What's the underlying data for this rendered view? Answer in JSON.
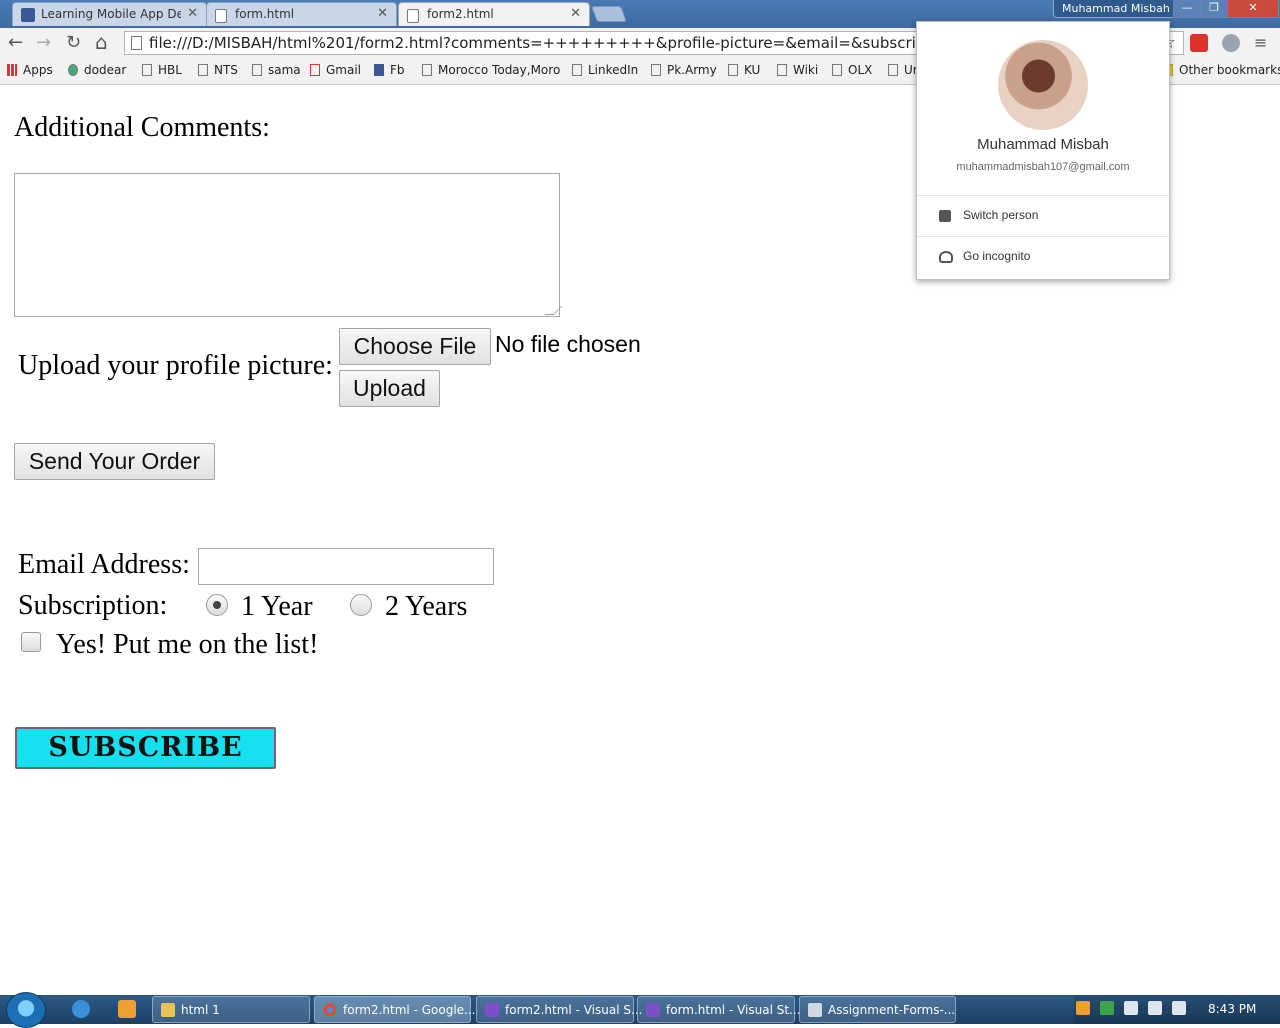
{
  "window": {
    "profile_name": "Muhammad Misbah",
    "min_glyph": "—",
    "max_glyph": "❐",
    "close_glyph": "✕"
  },
  "tabs": [
    {
      "label": "Learning Mobile App Deve",
      "favicon": "facebook-icon",
      "favicon_color": "#3b5998"
    },
    {
      "label": "form.html",
      "favicon": "document-icon",
      "favicon_color": "#ffffff"
    },
    {
      "label": "form2.html",
      "favicon": "document-icon",
      "favicon_color": "#ffffff",
      "active": true
    }
  ],
  "toolbar": {
    "back": "←",
    "forward": "→",
    "reload": "↻",
    "home": "⌂",
    "url": "file:///D:/MISBAH/html%201/form2.html?comments=+++++++++&profile-picture=&email=&subscription=",
    "star": "☆"
  },
  "bookmarks": [
    {
      "label": "Apps"
    },
    {
      "label": "dodear"
    },
    {
      "label": "HBL"
    },
    {
      "label": "NTS"
    },
    {
      "label": "sama"
    },
    {
      "label": "Gmail"
    },
    {
      "label": "Fb"
    },
    {
      "label": "Morocco Today,Moro"
    },
    {
      "label": "LinkedIn"
    },
    {
      "label": "Pk.Army"
    },
    {
      "label": "KU"
    },
    {
      "label": "Wiki"
    },
    {
      "label": "OLX"
    },
    {
      "label": "Ur"
    },
    {
      "label": "Other bookmarks"
    }
  ],
  "form": {
    "comments_label": "Additional Comments:",
    "upload_label": "Upload your profile picture:",
    "choose_file_button": "Choose File",
    "no_file_text": "No file chosen",
    "upload_button": "Upload",
    "send_button": "Send Your Order",
    "email_label": "Email Address:",
    "subscription_label": "Subscription:",
    "option_1": "1 Year",
    "option_2": "2 Years",
    "selected_option": "1 Year",
    "list_checkbox_label": "Yes! Put me on the list!",
    "subscribe_button": "SUBSCRIBE",
    "subscribe_color": "#14e0f0"
  },
  "profile_popup": {
    "name": "Muhammad Misbah",
    "email": "muhammadmisbah107@gmail.com",
    "switch_person": "Switch person",
    "go_incognito": "Go incognito"
  },
  "taskbar": {
    "tasks": [
      {
        "label": "html 1",
        "icon": "folder-icon",
        "icon_color": "#e8c35a"
      },
      {
        "label": "form2.html - Google...",
        "icon": "chrome-icon",
        "icon_color": "#e04a3a",
        "active": true
      },
      {
        "label": "form2.html - Visual S...",
        "icon": "visual-studio-icon",
        "icon_color": "#7d4fc9"
      },
      {
        "label": "form.html - Visual St...",
        "icon": "visual-studio-icon",
        "icon_color": "#7d4fc9"
      },
      {
        "label": "Assignment-Forms-...",
        "icon": "window-icon",
        "icon_color": "#d0d8e4"
      }
    ],
    "clock": "8:43 PM"
  }
}
